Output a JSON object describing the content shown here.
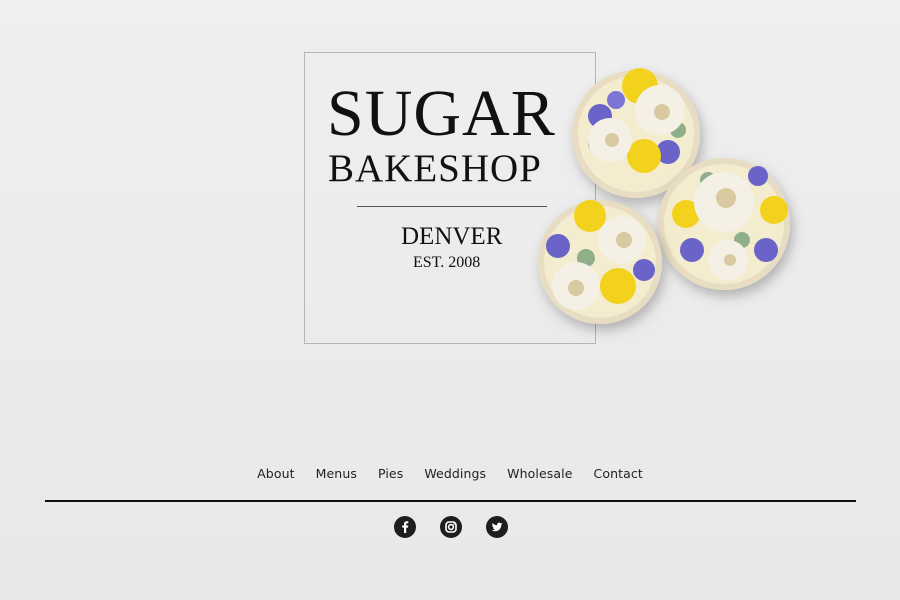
{
  "brand": {
    "line1": "SUGAR",
    "line2": "BAKESHOP",
    "city": "DENVER",
    "established": "EST. 2008"
  },
  "nav": {
    "items": [
      "About",
      "Menus",
      "Pies",
      "Weddings",
      "Wholesale",
      "Contact"
    ]
  },
  "social": {
    "icons": [
      "facebook-icon",
      "instagram-icon",
      "twitter-icon"
    ]
  },
  "colors": {
    "background": "#ececec",
    "text": "#111111",
    "frosting_white": "#f4f0e6",
    "frosting_yellow": "#f2d21b",
    "frosting_purple": "#6a64c8",
    "leaf_green": "#8fae8a"
  }
}
